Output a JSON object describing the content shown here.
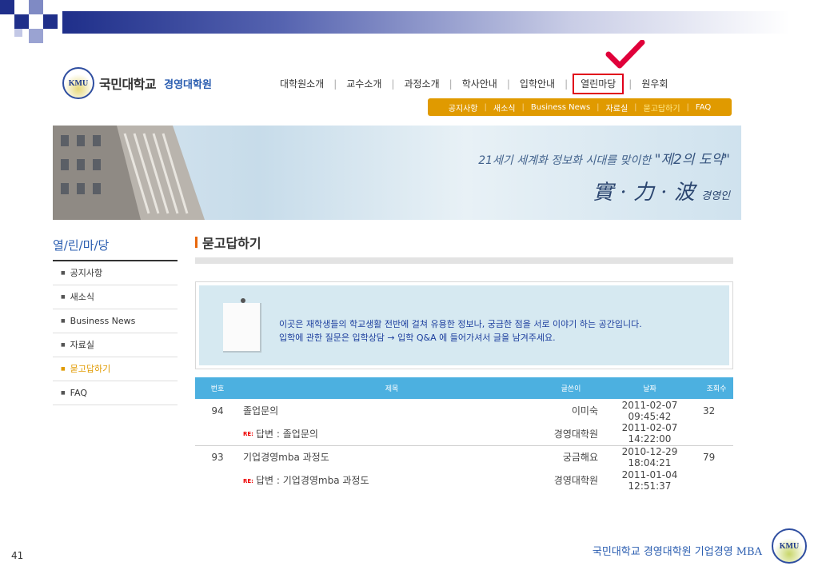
{
  "header": {
    "logo_text": "KMU",
    "university": "국민대학교",
    "school": "경영대학원",
    "menu": [
      "대학원소개",
      "교수소개",
      "과정소개",
      "학사안내",
      "입학안내",
      "열린마당",
      "원우회"
    ],
    "active_menu": "열린마당"
  },
  "subnav": [
    "공지사항",
    "새소식",
    "Business News",
    "자료실",
    "묻고답하기",
    "FAQ"
  ],
  "banner": {
    "line1": "21세기 세계화 정보화 시대를 맞이한 ",
    "line1_em": "\"제2의 도약\"",
    "line2": "實 · 力 · 波 ",
    "line2_small": "경영인"
  },
  "sidebar": {
    "title": "열/린/마/당",
    "items": [
      "공지사항",
      "새소식",
      "Business News",
      "자료실",
      "묻고답하기",
      "FAQ"
    ],
    "active": "묻고답하기"
  },
  "content": {
    "title": "묻고답하기",
    "notice_line1": "이곳은 재학생들의 학교생활 전반에 걸쳐 유용한 정보나, 궁금한 점을 서로 이야기 하는 공간입니다.",
    "notice_line2": "입학에 관한 질문은 입학상담 → 입학 Q&A 에 들어가셔서 글을 남겨주세요."
  },
  "table": {
    "headers": [
      "번호",
      "제목",
      "글쓴이",
      "날짜",
      "조회수"
    ],
    "re_tag": "RE:",
    "rows": [
      {
        "num": "94",
        "subject": "졸업문의",
        "reply": false,
        "writer": "이미숙",
        "date": "2011-02-07 09:45:42",
        "views": "32"
      },
      {
        "num": "",
        "subject": "답변 : 졸업문의",
        "reply": true,
        "writer": "경영대학원",
        "date": "2011-02-07 14:22:00",
        "views": ""
      },
      {
        "num": "93",
        "subject": "기업경영mba 과정도",
        "reply": false,
        "writer": "궁금해요",
        "date": "2010-12-29 18:04:21",
        "views": "79"
      },
      {
        "num": "",
        "subject": "답변 : 기업경영mba 과정도",
        "reply": true,
        "writer": "경영대학원",
        "date": "2011-01-04 12:51:37",
        "views": ""
      }
    ]
  },
  "footer": {
    "page_number": "41",
    "text": "국민대학교 경영대학원 기업경영 MBA",
    "logo_text": "KMU"
  },
  "colors": {
    "accent_orange": "#e09a00",
    "table_header": "#4cb0e0",
    "brand_blue": "#2a5db0",
    "highlight_red": "#e0001a"
  }
}
